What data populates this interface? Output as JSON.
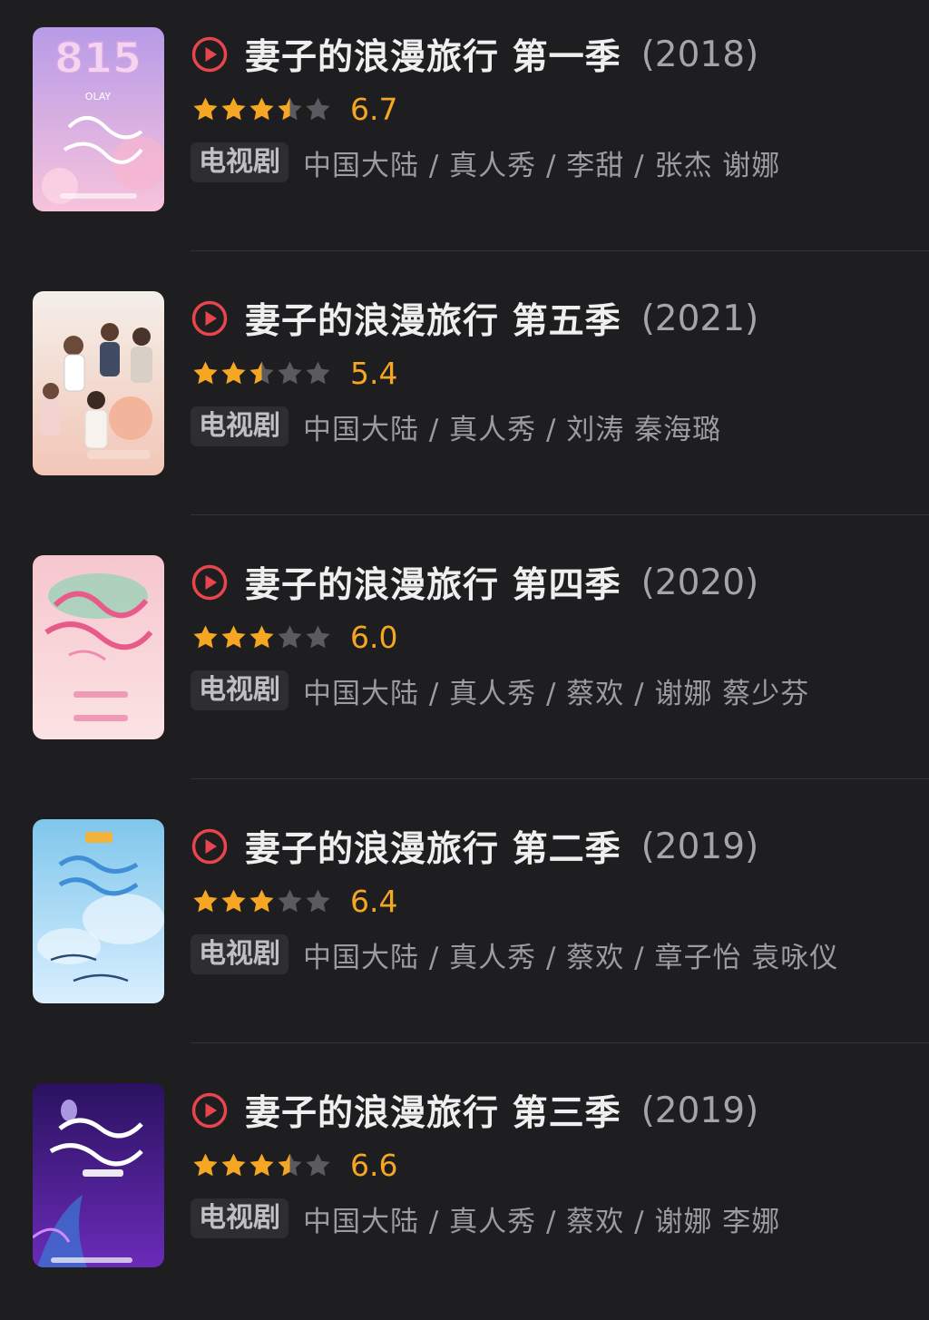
{
  "items": [
    {
      "title": "妻子的浪漫旅行 第一季",
      "year": "(2018)",
      "rating": 6.7,
      "score_text": "6.7",
      "stars": 3.5,
      "tag": "电视剧",
      "info": "中国大陆 / 真人秀 / 李甜 / 张杰 谢娜",
      "poster_text": "815",
      "poster_bg": [
        "#b79be8",
        "#f7c3dc"
      ]
    },
    {
      "title": "妻子的浪漫旅行 第五季",
      "year": "(2021)",
      "rating": 5.4,
      "score_text": "5.4",
      "stars": 2.5,
      "tag": "电视剧",
      "info": "中国大陆 / 真人秀 / 刘涛 秦海璐",
      "poster_text": "",
      "poster_bg": [
        "#f4efe9",
        "#f2c6b7"
      ]
    },
    {
      "title": "妻子的浪漫旅行 第四季",
      "year": "(2020)",
      "rating": 6.0,
      "score_text": "6.0",
      "stars": 3,
      "tag": "电视剧",
      "info": "中国大陆 / 真人秀 / 蔡欢 / 谢娜 蔡少芬",
      "poster_text": "",
      "poster_bg": [
        "#f6c6cf",
        "#fbe3e3"
      ]
    },
    {
      "title": "妻子的浪漫旅行 第二季",
      "year": "(2019)",
      "rating": 6.4,
      "score_text": "6.4",
      "stars": 3,
      "tag": "电视剧",
      "info": "中国大陆 / 真人秀 / 蔡欢 / 章子怡 袁咏仪",
      "poster_text": "",
      "poster_bg": [
        "#7fc6ec",
        "#d9efff"
      ]
    },
    {
      "title": "妻子的浪漫旅行 第三季",
      "year": "(2019)",
      "rating": 6.6,
      "score_text": "6.6",
      "stars": 3.5,
      "tag": "电视剧",
      "info": "中国大陆 / 真人秀 / 蔡欢 / 谢娜 李娜",
      "poster_text": "",
      "poster_bg": [
        "#2a1260",
        "#6a2bb8"
      ]
    }
  ],
  "colors": {
    "background": "#1e1e20",
    "star_filled": "#f5a623",
    "star_empty": "#5a5a60",
    "play_icon": "#e8454c",
    "score": "#f5a623"
  }
}
